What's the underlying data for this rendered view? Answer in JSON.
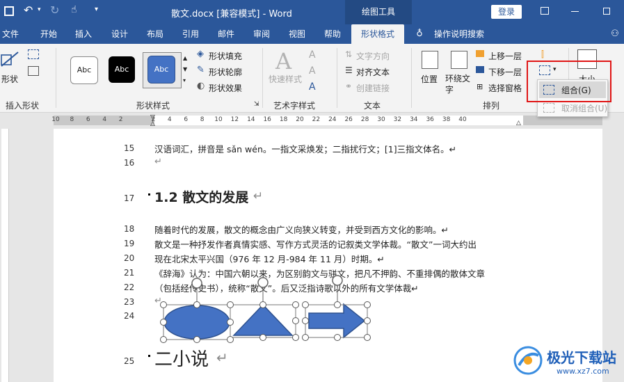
{
  "titlebar": {
    "doc_title": "散文.docx [兼容模式]  -  Word",
    "context_tab": "绘图工具",
    "login": "登录"
  },
  "tabs": [
    "文件",
    "开始",
    "插入",
    "设计",
    "布局",
    "引用",
    "邮件",
    "审阅",
    "视图",
    "帮助",
    "形状格式"
  ],
  "search_hint": "操作说明搜索",
  "ribbon": {
    "insert_shapes": {
      "label": "插入形状",
      "shape_btn": "形状"
    },
    "shape_styles": {
      "label": "形状样式",
      "style_samples": [
        "Abc",
        "Abc",
        "Abc"
      ],
      "fill": "形状填充",
      "outline": "形状轮廓",
      "effect": "形状效果"
    },
    "wordart": {
      "label": "艺术字样式",
      "quick": "快速样式"
    },
    "text": {
      "label": "文本",
      "direction": "文字方向",
      "align": "对齐文本",
      "link": "创建链接"
    },
    "arrange": {
      "label": "排列",
      "position": "位置",
      "wrap": "环绕文字",
      "forward": "上移一层",
      "backward": "下移一层",
      "selection": "选择窗格"
    },
    "size": {
      "label": "大小"
    }
  },
  "group_menu": {
    "group": "组合(G)",
    "ungroup": "取消组合(U)"
  },
  "ruler_ticks": [
    "10",
    "8",
    "6",
    "4",
    "2",
    "",
    "2",
    "4",
    "6",
    "8",
    "10",
    "12",
    "14",
    "16",
    "18",
    "20",
    "22",
    "24",
    "26",
    "28",
    "30",
    "32",
    "34",
    "36",
    "38",
    "40"
  ],
  "lines": [
    {
      "num": "15",
      "text": "汉语词汇，拼音是 sǎn wén。一指文采焕发；二指扰行文；[1]三指文体名。↵"
    },
    {
      "num": "16",
      "text": "↵"
    },
    {
      "num": "17",
      "text": "1.2 散文的发展"
    },
    {
      "num": "18",
      "text": "随着时代的发展，散文的概念由广义向狭义转变，并受到西方文化的影响。↵"
    },
    {
      "num": "19",
      "text": "散文是一种抒发作者真情实感、写作方式灵活的记叙类文学体裁。“散文”一词大约出"
    },
    {
      "num": "20",
      "text": "现在北宋太平兴国（976 年 12 月-984 年 11 月）时期。↵"
    },
    {
      "num": "21",
      "text": "《辞海》认为：中国六朝以来，为区别韵文与骈文，把凡不押韵、不重排偶的散体文章"
    },
    {
      "num": "22",
      "text": "（包括经传史书），统称“散文”。后又泛指诗歌以外的所有文学体裁↵"
    },
    {
      "num": "23",
      "text": "↵"
    },
    {
      "num": "24",
      "text": ""
    },
    {
      "num": "25",
      "text": "二小说"
    }
  ],
  "colors": {
    "brand": "#2b579a",
    "shape_fill": "#4472c4",
    "highlight": "#e01515"
  },
  "watermark": {
    "text": "极光下载站",
    "url": "www.xz7.com"
  }
}
